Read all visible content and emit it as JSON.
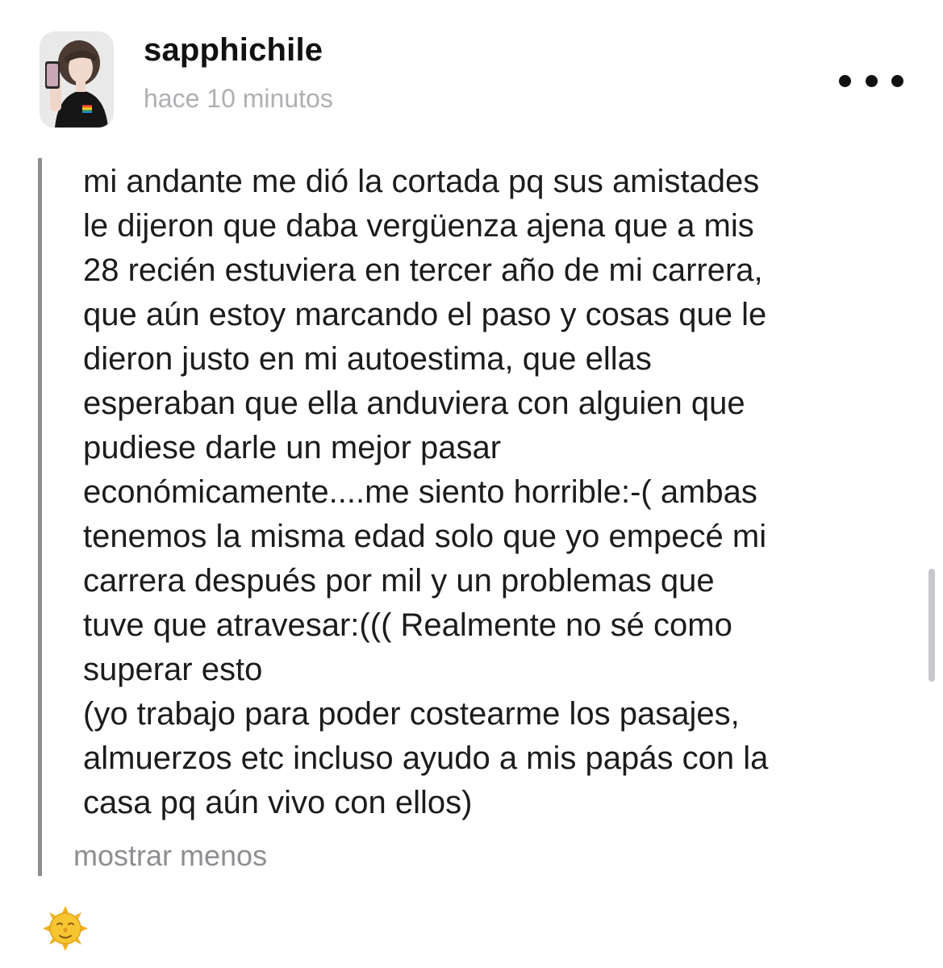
{
  "post": {
    "username": "sapphichile",
    "timestamp": "hace 10 minutos",
    "body_lines": [
      "mi andante me dió la cortada pq sus amistades",
      "le dijeron que daba vergüenza ajena que a mis",
      "28 recién estuviera en tercer año de mi carrera,",
      "que aún estoy marcando el paso y cosas que le",
      "dieron justo en mi autoestima, que ellas",
      "esperaban que ella anduviera con alguien que",
      "pudiese darle un mejor pasar",
      "económicamente....me siento horrible:-( ambas",
      "tenemos la misma edad solo que yo empecé mi",
      "carrera después por mil y un problemas que",
      "tuve que atravesar:((( Realmente no sé como",
      "superar esto",
      "(yo trabajo para poder costearme los pasajes,",
      "almuerzos etc incluso ayudo a mis papás con la",
      "casa pq aún vivo con ellos)"
    ],
    "show_less_label": "mostrar menos"
  },
  "icons": {
    "more": "more-horizontal-icon",
    "reaction": "sun-with-face-icon",
    "avatar": "profile-photo"
  },
  "colors": {
    "text": "#1c1c1e",
    "username": "#111111",
    "timestamp": "#b0b0b4",
    "secondary": "#8e8e93",
    "quote_bar": "#8e8e93",
    "background": "#ffffff"
  }
}
